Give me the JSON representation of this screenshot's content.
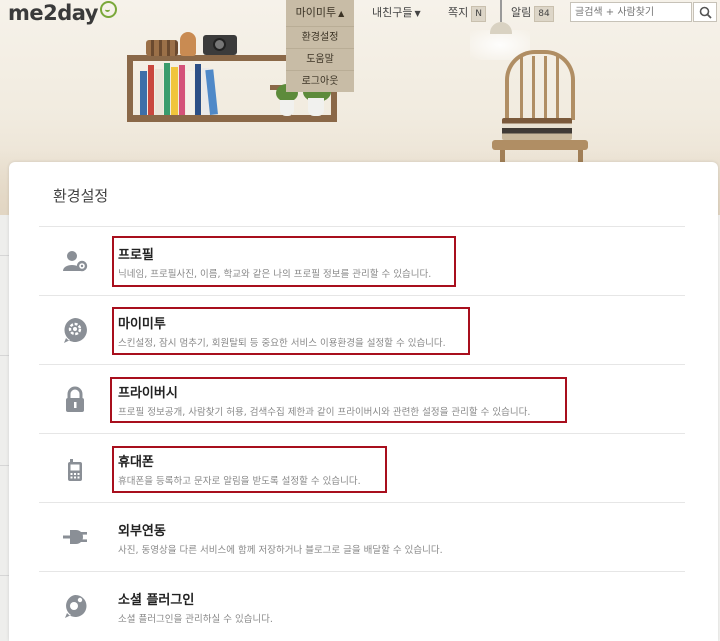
{
  "app": {
    "logo": "me2day"
  },
  "nav": {
    "mime_label": "마이미투",
    "friends_label": "내친구들",
    "note_label": "쪽지",
    "note_badge": "N",
    "alarm_label": "알림",
    "alarm_badge": "84"
  },
  "search": {
    "placeholder": "글검색 + 사람찾기"
  },
  "dropdown": {
    "items": [
      "환경설정",
      "도움말",
      "로그아웃"
    ]
  },
  "page": {
    "title": "환경설정"
  },
  "settings": [
    {
      "title": "프로필",
      "desc": "닉네임, 프로필사진, 이름, 학교와 같은 나의 프로필 정보를 관리할 수 있습니다.",
      "icon": "profile-settings-icon",
      "highlighted": true
    },
    {
      "title": "마이미투",
      "desc": "스킨설정, 잠시 멈추기, 회원탈퇴 등 중요한 서비스 이용환경을 설정할 수 있습니다.",
      "icon": "gear-bubble-icon",
      "highlighted": true
    },
    {
      "title": "프라이버시",
      "desc": "프로필 정보공개, 사람찾기 허용, 검색수집 제한과 같이 프라이버시와 관련한 설정을 관리할 수 있습니다.",
      "icon": "lock-icon",
      "highlighted": true
    },
    {
      "title": "휴대폰",
      "desc": "휴대폰을 등록하고 문자로 알림을 받도록 설정할 수 있습니다.",
      "icon": "mobile-phone-icon",
      "highlighted": true
    },
    {
      "title": "외부연동",
      "desc": "사진, 동영상을 다른 서비스에 함께 저장하거나 블로그로 글을 배달할 수 있습니다.",
      "icon": "plug-icon",
      "highlighted": false
    },
    {
      "title": "소셜 플러그인",
      "desc": "소셜 플러그인을 관리하실 수 있습니다.",
      "icon": "social-plugin-icon",
      "highlighted": false
    }
  ],
  "colors": {
    "highlight": "#a80f1d",
    "nav_active": "#c8bca6",
    "logo_accent": "#7aa83a"
  }
}
